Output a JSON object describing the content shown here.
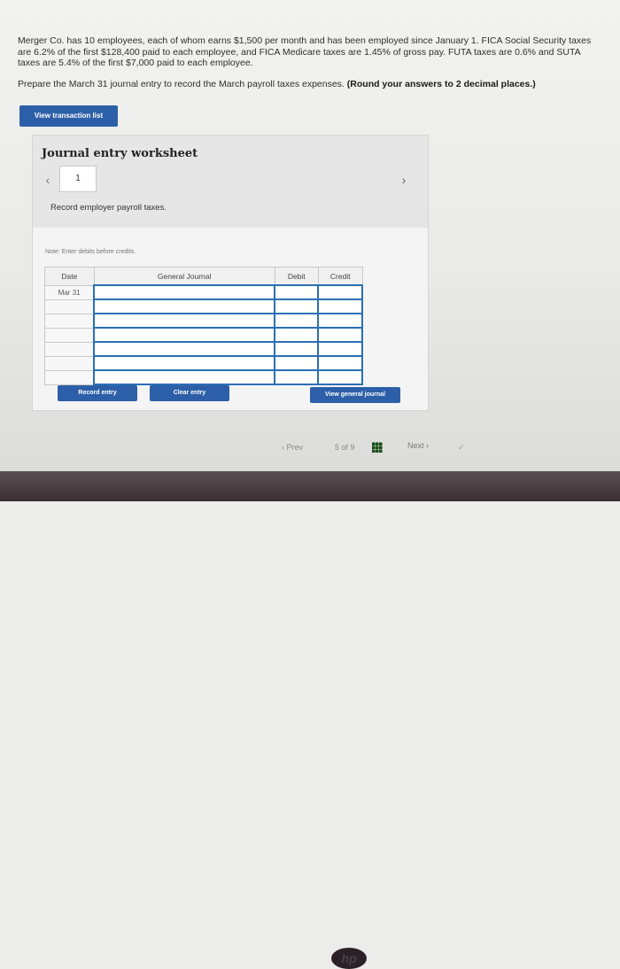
{
  "question": {
    "text": "Merger Co. has 10 employees, each of whom earns $1,500 per month and has been employed since January 1. FICA Social Security taxes are 6.2% of the first $128,400 paid to each employee, and FICA Medicare taxes are 1.45% of gross pay. FUTA taxes are 0.6% and SUTA taxes are 5.4% of the first $7,000 paid to each employee.",
    "prompt": "Prepare the March 31 journal entry to record the March payroll taxes expenses.",
    "instruction": "(Round your answers to 2 decimal places.)"
  },
  "buttons": {
    "view_transaction_list": "View transaction list",
    "record_entry": "Record entry",
    "clear_entry": "Clear entry",
    "view_general_journal": "View general journal"
  },
  "worksheet": {
    "title": "Journal entry worksheet",
    "entry_number": "1",
    "description": "Record employer payroll taxes.",
    "note": "Note: Enter debits before credits.",
    "prev_icon": "‹",
    "next_icon": "›"
  },
  "table": {
    "headers": {
      "date": "Date",
      "general_journal": "General Journal",
      "debit": "Debit",
      "credit": "Credit"
    },
    "rows": [
      {
        "date": "Mar 31",
        "account": "",
        "debit": "",
        "credit": ""
      },
      {
        "date": "",
        "account": "",
        "debit": "",
        "credit": ""
      },
      {
        "date": "",
        "account": "",
        "debit": "",
        "credit": ""
      },
      {
        "date": "",
        "account": "",
        "debit": "",
        "credit": ""
      },
      {
        "date": "",
        "account": "",
        "debit": "",
        "credit": ""
      },
      {
        "date": "",
        "account": "",
        "debit": "",
        "credit": ""
      },
      {
        "date": "",
        "account": "",
        "debit": "",
        "credit": ""
      }
    ]
  },
  "pagination": {
    "prev": "‹ Prev",
    "position": "5 of 9",
    "next": "Next ›"
  },
  "colors": {
    "accent": "#2d5fa8",
    "input_border": "#2a6fb5"
  },
  "icons": {
    "grid": "grid-icon",
    "check": "check-icon"
  }
}
